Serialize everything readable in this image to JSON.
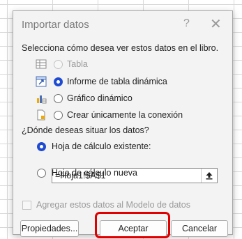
{
  "dialog": {
    "title": "Importar datos",
    "help_glyph": "?",
    "close_glyph": "✕",
    "view_prompt": "Selecciona cómo desea ver estos datos en el libro.",
    "view_options": [
      {
        "label": "Tabla",
        "state": "disabled"
      },
      {
        "label": "Informe de tabla dinámica",
        "state": "checked"
      },
      {
        "label": "Gráfico dinámico",
        "state": "unchecked"
      },
      {
        "label": "Crear únicamente la conexión",
        "state": "unchecked"
      }
    ],
    "location_prompt": "¿Dónde deseas situar los datos?",
    "location_options": [
      {
        "label": "Hoja de cálculo existente:",
        "state": "checked"
      },
      {
        "label": "Hoja de cálculo nueva",
        "state": "unchecked"
      }
    ],
    "reference_value": "=Hoja1!$A$1",
    "data_model_label": "Agregar estos datos al Modelo de datos",
    "buttons": {
      "properties": "Propiedades...",
      "accept": "Aceptar",
      "cancel": "Cancelar"
    }
  },
  "colors": {
    "accent": "#1e4bd2",
    "highlight": "#e00000"
  }
}
